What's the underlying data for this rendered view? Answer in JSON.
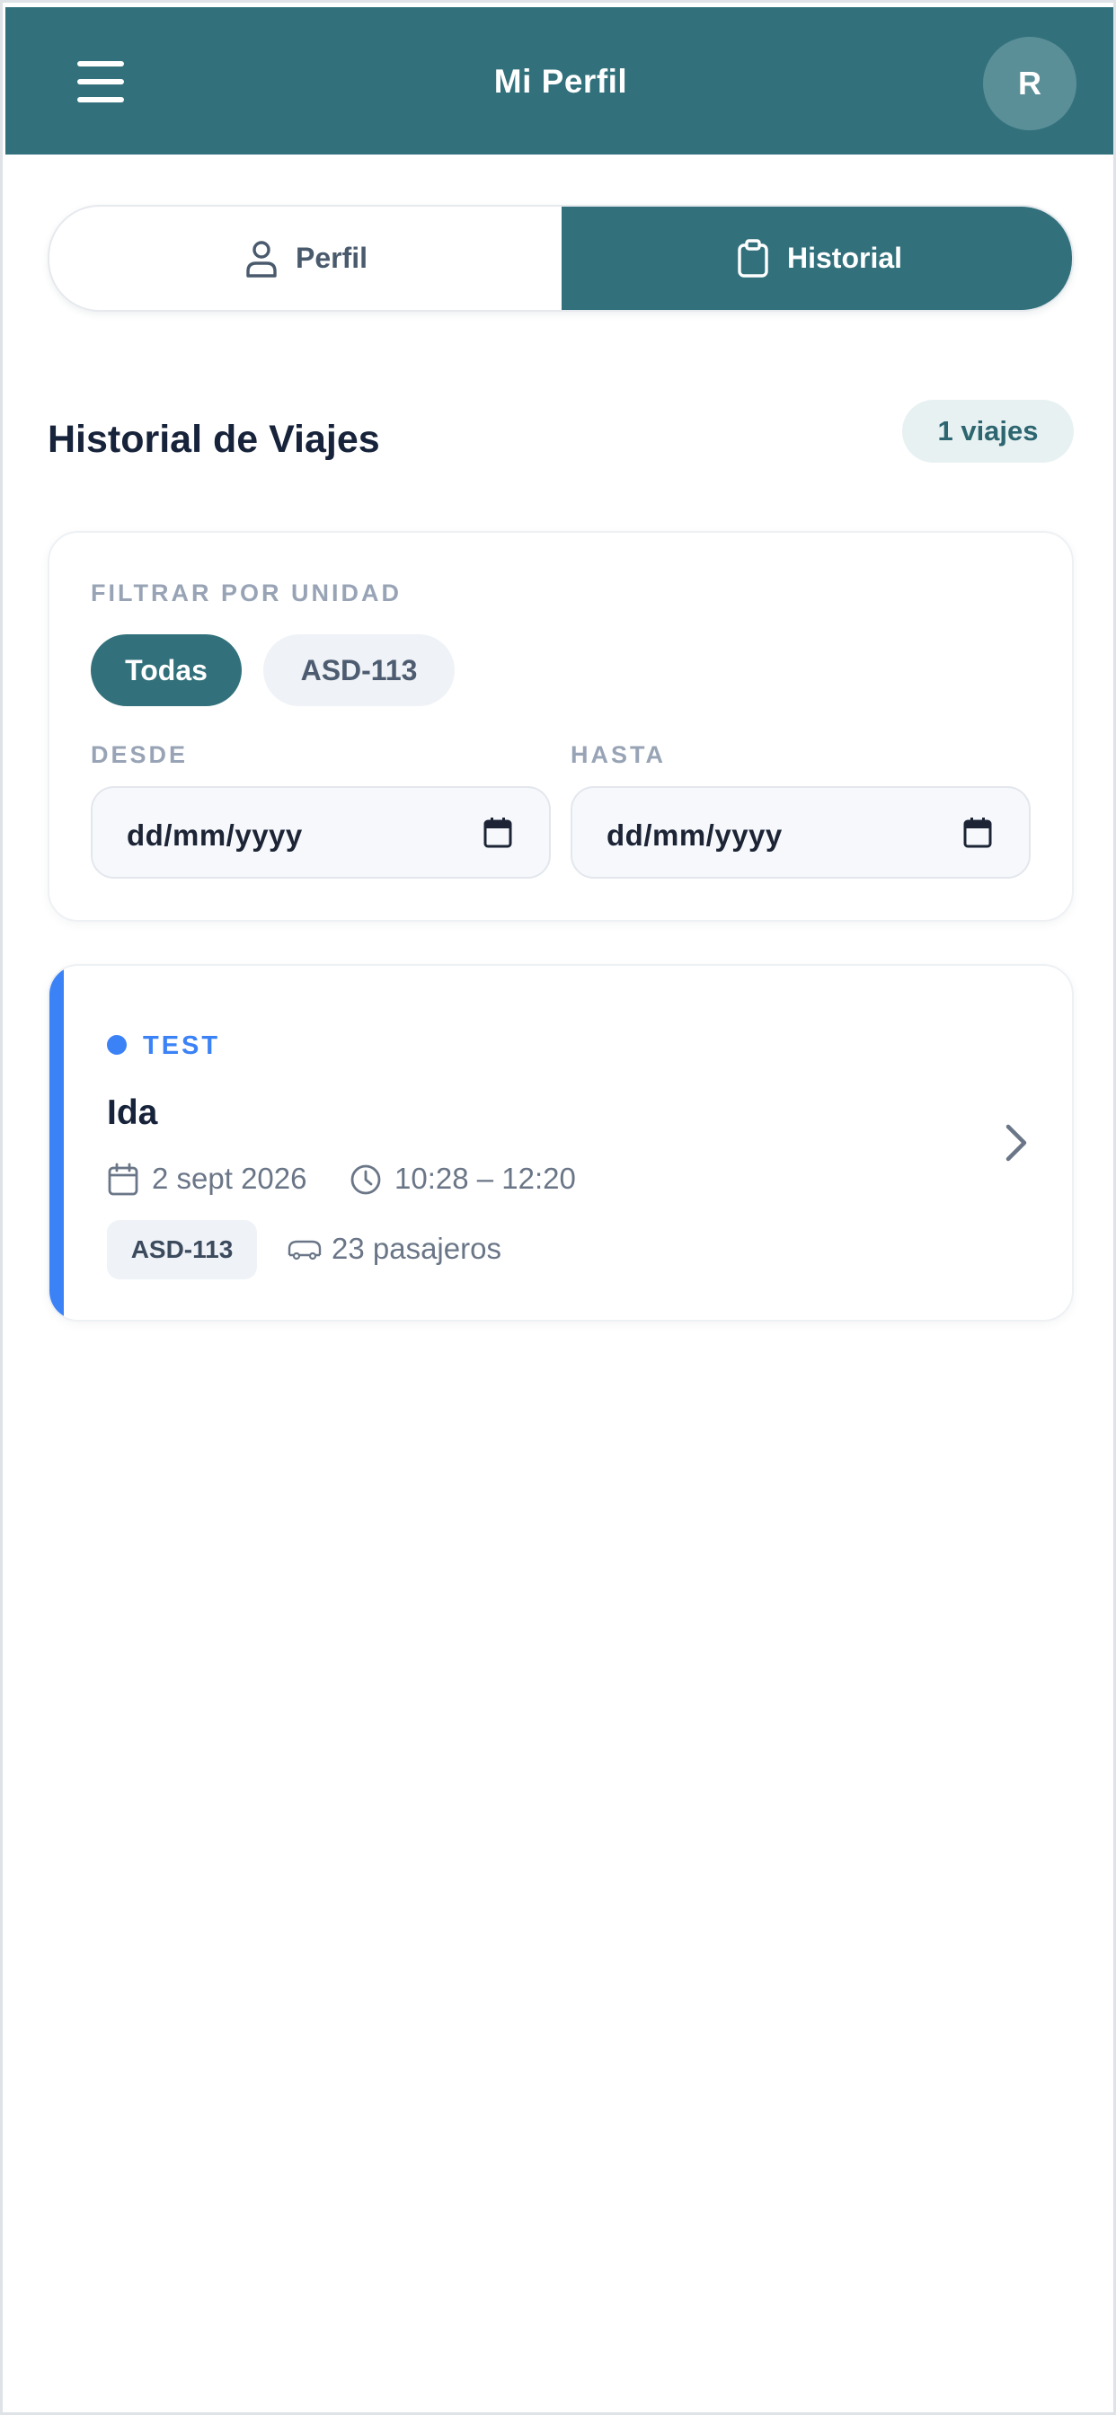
{
  "header": {
    "title": "Mi Perfil",
    "menu_icon": "hamburger-menu-icon",
    "avatar_initial": "R",
    "background_color": "#32717c"
  },
  "tabs": [
    {
      "label": "Perfil",
      "icon": "user-icon",
      "active": false
    },
    {
      "label": "Historial",
      "icon": "clipboard-icon",
      "active": true
    }
  ],
  "history": {
    "title": "Historial de Viajes",
    "count_badge": "1 viajes"
  },
  "filters": {
    "unit_label": "FILTRAR POR UNIDAD",
    "unit_options": [
      {
        "label": "Todas",
        "selected": true
      },
      {
        "label": "ASD-113",
        "selected": false
      }
    ],
    "from_label": "DESDE",
    "from_placeholder": "dd/mm/yyyy",
    "to_label": "HASTA",
    "to_placeholder": "dd/mm/yyyy"
  },
  "trips": [
    {
      "status": "TEST",
      "status_color": "#3b82f6",
      "direction": "Ida",
      "date": "2 sept 2026",
      "time": "10:28 – 12:20",
      "unit": "ASD-113",
      "passengers": "23 pasajeros"
    }
  ]
}
